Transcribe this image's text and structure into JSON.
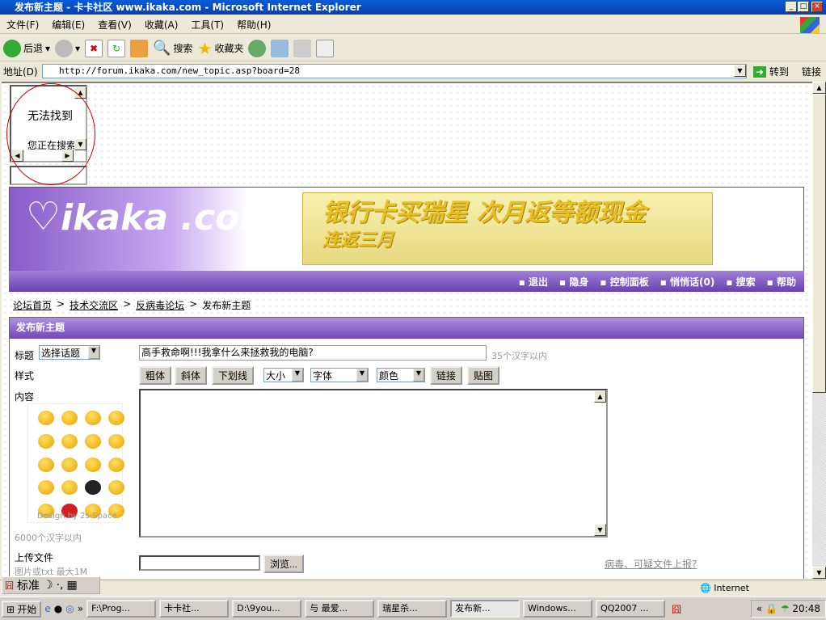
{
  "window": {
    "title": "发布新主题 - 卡卡社区 www.ikaka.com - Microsoft Internet Explorer"
  },
  "menu": [
    "文件(F)",
    "编辑(E)",
    "查看(V)",
    "收藏(A)",
    "工具(T)",
    "帮助(H)"
  ],
  "toolbar": {
    "back": "后退",
    "search": "搜索",
    "favorites": "收藏夹"
  },
  "address": {
    "label": "地址(D)",
    "url": "http://forum.ikaka.com/new_topic.asp?board=28",
    "go": "转到",
    "links": "链接"
  },
  "frame": {
    "error_title": "无法找到",
    "error_sub": "您正在搜索"
  },
  "banner": {
    "logo": "ikaka .com",
    "ad_line1": "银行卡买瑞星  次月返等额现金",
    "ad_line2": "连返三月"
  },
  "nav": [
    "退出",
    "隐身",
    "控制面板",
    "悄悄话(0)",
    "搜索",
    "帮助"
  ],
  "breadcrumb": [
    "论坛首页",
    "技术交流区",
    "反病毒论坛",
    "发布新主题"
  ],
  "form": {
    "header": "发布新主题",
    "title_label": "标题",
    "topic_select": "选择话题",
    "title_value": "高手救命啊!!!我拿什么来拯救我的电脑?",
    "title_hint": "35个汉字以内",
    "style_label": "样式",
    "bold": "粗体",
    "italic": "斜体",
    "underline": "下划线",
    "size": "大小",
    "font": "字体",
    "color": "颜色",
    "link": "链接",
    "image": "贴图",
    "content_label": "内容",
    "smiley_credit": "Design by 2s-Space",
    "content_hint": "6000个汉字以内",
    "upload_label": "上传文件",
    "upload_hint": "图片或txt 最大1M",
    "browse": "浏览...",
    "report_link": "病毒、可疑文件上报?"
  },
  "ime": {
    "mode": "标准"
  },
  "status": {
    "zone": "Internet"
  },
  "taskbar": {
    "start": "开始",
    "tasks": [
      "F:\\Prog...",
      "卡卡社...",
      "D:\\9you...",
      "与 最爱...",
      "瑞星杀...",
      "发布新...",
      "Windows...",
      "QQ2007 ..."
    ],
    "active": 5,
    "clock": "20:48"
  }
}
